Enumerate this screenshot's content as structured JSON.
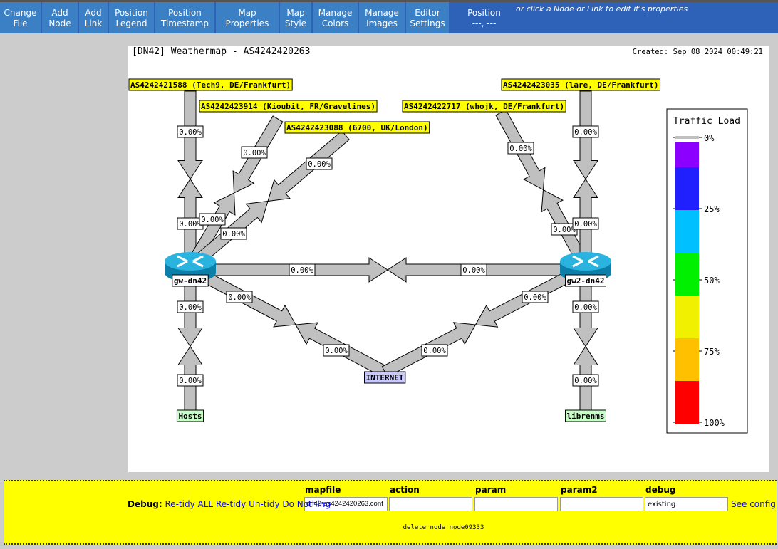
{
  "toolbar": {
    "buttons": [
      {
        "l1": "Change",
        "l2": "File"
      },
      {
        "l1": "Add",
        "l2": "Node"
      },
      {
        "l1": "Add",
        "l2": "Link"
      },
      {
        "l1": "Position",
        "l2": "Legend"
      },
      {
        "l1": "Position",
        "l2": "Timestamp"
      },
      {
        "l1": "Map",
        "l2": "Properties"
      },
      {
        "l1": "Map",
        "l2": "Style"
      },
      {
        "l1": "Manage",
        "l2": "Colors"
      },
      {
        "l1": "Manage",
        "l2": "Images"
      },
      {
        "l1": "Editor",
        "l2": "Settings"
      }
    ],
    "position_label": "Position",
    "position_value": "---, ---",
    "hint": "or click a Node or Link to edit it's properties"
  },
  "map": {
    "title": "[DN42] Weathermap - AS4242420263",
    "created": "Created: Sep 08 2024 00:49:21",
    "nodes": {
      "tech9": "AS4242421588 (Tech9, DE/Frankfurt)",
      "kioubit": "AS4242423914 (Kioubit, FR/Gravelines)",
      "n6700": "AS4242423088 (6700, UK/London)",
      "whojk": "AS4242422717 (whojk, DE/Frankfurt)",
      "lare": "AS4242423035 (lare, DE/Frankfurt)",
      "gw": "gw-dn42",
      "gw2": "gw2-dn42",
      "internet": "INTERNET",
      "hosts": "Hosts",
      "librenms": "librenms"
    },
    "link_label": "0.00%",
    "link_color": "#c0c0c0",
    "legend": {
      "title": "Traffic Load",
      "ticks": [
        "0%",
        "25%",
        "50%",
        "75%",
        "100%"
      ],
      "colors": [
        "#c0c0c0",
        "#8c00ff",
        "#2020ff",
        "#00c0ff",
        "#00f000",
        "#f0f000",
        "#ffc000",
        "#ff0000"
      ]
    }
  },
  "debug": {
    "label": "Debug:",
    "links": [
      "Re-tidy ALL",
      "Re-tidy",
      "Un-tidy",
      "Do Nothing"
    ],
    "headers": [
      "mapfile",
      "action",
      "param",
      "param2",
      "debug"
    ],
    "values": [
      "dn42-as4242420263.conf",
      "",
      "",
      "",
      "existing"
    ],
    "see_config": "See config",
    "message": "delete node node09333"
  }
}
